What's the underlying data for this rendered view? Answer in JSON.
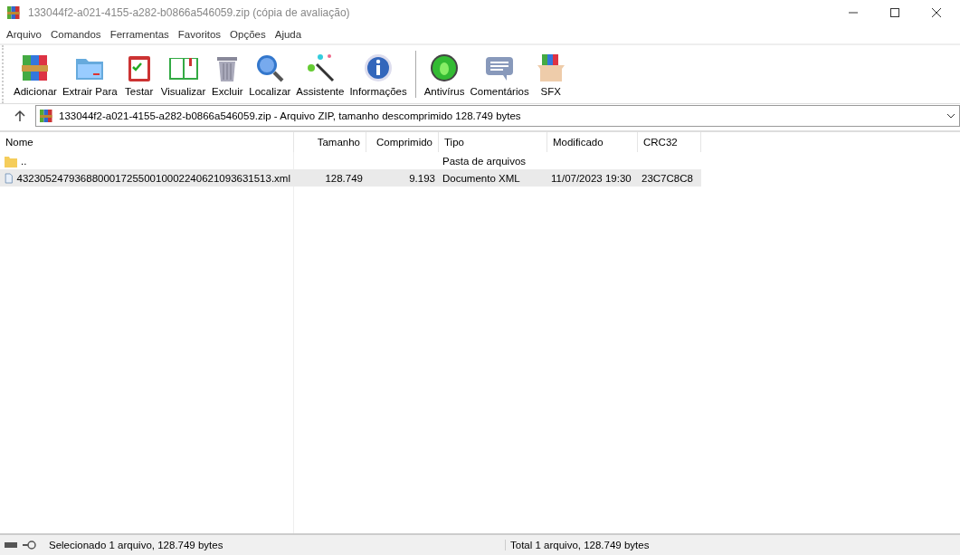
{
  "window": {
    "title": "133044f2-a021-4155-a282-b0866a546059.zip (cópia de avaliação)"
  },
  "menu": [
    "Arquivo",
    "Comandos",
    "Ferramentas",
    "Favoritos",
    "Opções",
    "Ajuda"
  ],
  "toolbar": [
    {
      "label": "Adicionar"
    },
    {
      "label": "Extrair Para"
    },
    {
      "label": "Testar"
    },
    {
      "label": "Visualizar"
    },
    {
      "label": "Excluir"
    },
    {
      "label": "Localizar"
    },
    {
      "label": "Assistente"
    },
    {
      "label": "Informações"
    },
    {
      "label": "Antivírus"
    },
    {
      "label": "Comentários"
    },
    {
      "label": "SFX"
    }
  ],
  "address": {
    "value": "133044f2-a021-4155-a282-b0866a546059.zip - Arquivo ZIP, tamanho descomprimido 128.749 bytes"
  },
  "table": {
    "columns": [
      "Nome",
      "Tamanho",
      "Comprimido",
      "Tipo",
      "Modificado",
      "CRC32"
    ],
    "rows": [
      {
        "kind": "folder",
        "selected": false,
        "cells": [
          "..",
          "",
          "",
          "Pasta de arquivos",
          "",
          ""
        ]
      },
      {
        "kind": "file",
        "selected": true,
        "cells": [
          "43230524793688000172550010002240621093631513.xml",
          "128.749",
          "9.193",
          "Documento XML",
          "11/07/2023 19:30",
          "23C7C8C8"
        ]
      }
    ]
  },
  "status_bar": {
    "left": "Selecionado 1 arquivo, 128.749 bytes",
    "right": "Total 1 arquivo, 128.749 bytes"
  }
}
